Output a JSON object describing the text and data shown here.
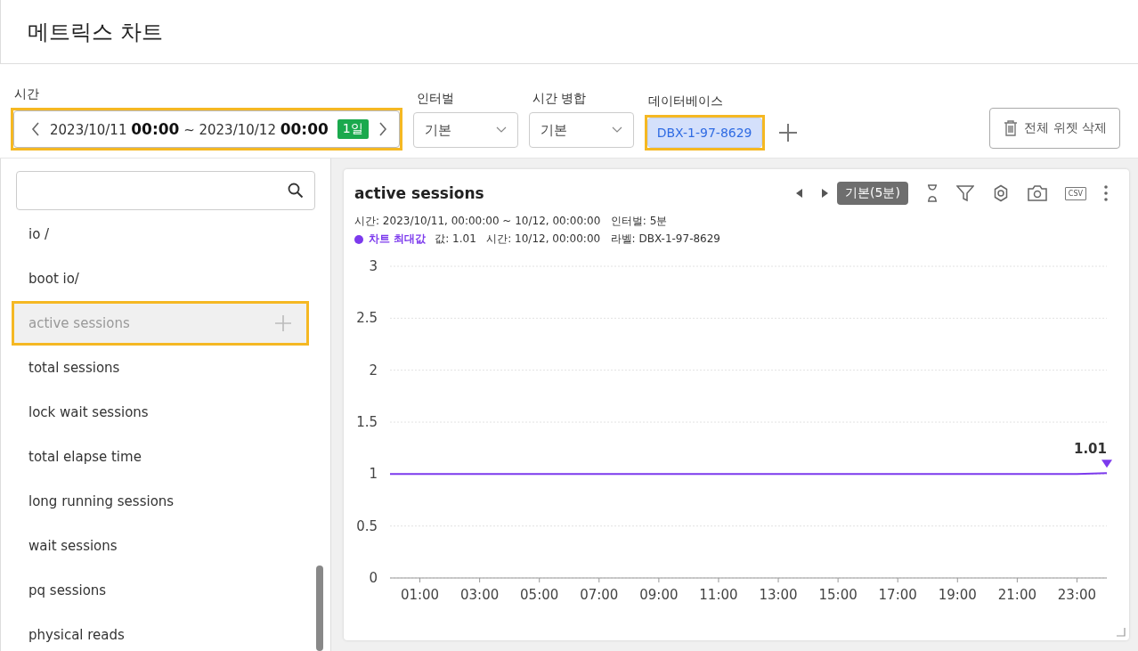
{
  "page": {
    "title": "메트릭스 차트"
  },
  "filters": {
    "time": {
      "label": "시간",
      "range": "2023/10/11 **00:00** ~ 2023/10/12 **00:00**",
      "badge": "1일",
      "highlighted": true
    },
    "interval": {
      "label": "인터벌",
      "value": "기본"
    },
    "merge": {
      "label": "시간 병합",
      "value": "기본"
    },
    "database": {
      "label": "데이터베이스",
      "chips": [
        {
          "text": "DBX-1-97-8629",
          "highlighted": true
        }
      ]
    },
    "delete_button": "전체 위젯 삭제"
  },
  "sidebar": {
    "items": [
      {
        "label": "io /",
        "selected": false,
        "highlighted": false
      },
      {
        "label": "boot io/",
        "selected": false,
        "highlighted": false
      },
      {
        "label": "active sessions",
        "selected": true,
        "highlighted": true
      },
      {
        "label": "total sessions",
        "selected": false,
        "highlighted": false
      },
      {
        "label": "lock wait sessions",
        "selected": false,
        "highlighted": false
      },
      {
        "label": "total elapse time",
        "selected": false,
        "highlighted": false
      },
      {
        "label": "long running sessions",
        "selected": false,
        "highlighted": false
      },
      {
        "label": "wait sessions",
        "selected": false,
        "highlighted": false
      },
      {
        "label": "pq sessions",
        "selected": false,
        "highlighted": false
      },
      {
        "label": "physical reads",
        "selected": false,
        "highlighted": false
      }
    ]
  },
  "widget": {
    "title": "active sessions",
    "mode_badge": "기본(5분)",
    "csv_label": "CSV",
    "info": "시간: 2023/10/11, 00:00:00 ~ 10/12, 00:00:00   인터벌: 5분",
    "legend": {
      "name": "차트 최대값",
      "color": "#7c3aed",
      "detail": "값: 1.01   시간: 10/12, 00:00:00   라벨: DBX-1-97-8629"
    },
    "chart_data": {
      "type": "line",
      "x": [
        0,
        1,
        2,
        3,
        4,
        5,
        6,
        7,
        8,
        9,
        10,
        11,
        12,
        13,
        14,
        15,
        16,
        17,
        18,
        19,
        20,
        21,
        22,
        23,
        24
      ],
      "grid": true,
      "series": [
        {
          "color": "#7c3aed",
          "values": [
            1,
            1,
            1,
            1,
            1,
            1,
            1,
            1,
            1,
            1,
            1,
            1,
            1,
            1,
            1,
            1,
            1,
            1,
            1,
            1,
            1,
            1,
            1,
            1,
            1.01
          ]
        }
      ],
      "xlim": [
        0,
        24
      ],
      "ylim": [
        0,
        3
      ],
      "xticks": [
        {
          "value": 1,
          "label": "01:00"
        },
        {
          "value": 3,
          "label": "03:00"
        },
        {
          "value": 5,
          "label": "05:00"
        },
        {
          "value": 7,
          "label": "07:00"
        },
        {
          "value": 9,
          "label": "09:00"
        },
        {
          "value": 11,
          "label": "11:00"
        },
        {
          "value": 13,
          "label": "13:00"
        },
        {
          "value": 15,
          "label": "15:00"
        },
        {
          "value": 17,
          "label": "17:00"
        },
        {
          "value": 19,
          "label": "19:00"
        },
        {
          "value": 21,
          "label": "21:00"
        },
        {
          "value": 23,
          "label": "23:00"
        }
      ],
      "yticks": [
        0,
        0.5,
        1,
        1.5,
        2,
        2.5,
        3
      ],
      "annotations": [
        {
          "x": 24,
          "y": 1.01,
          "text": "1.01"
        }
      ]
    }
  }
}
